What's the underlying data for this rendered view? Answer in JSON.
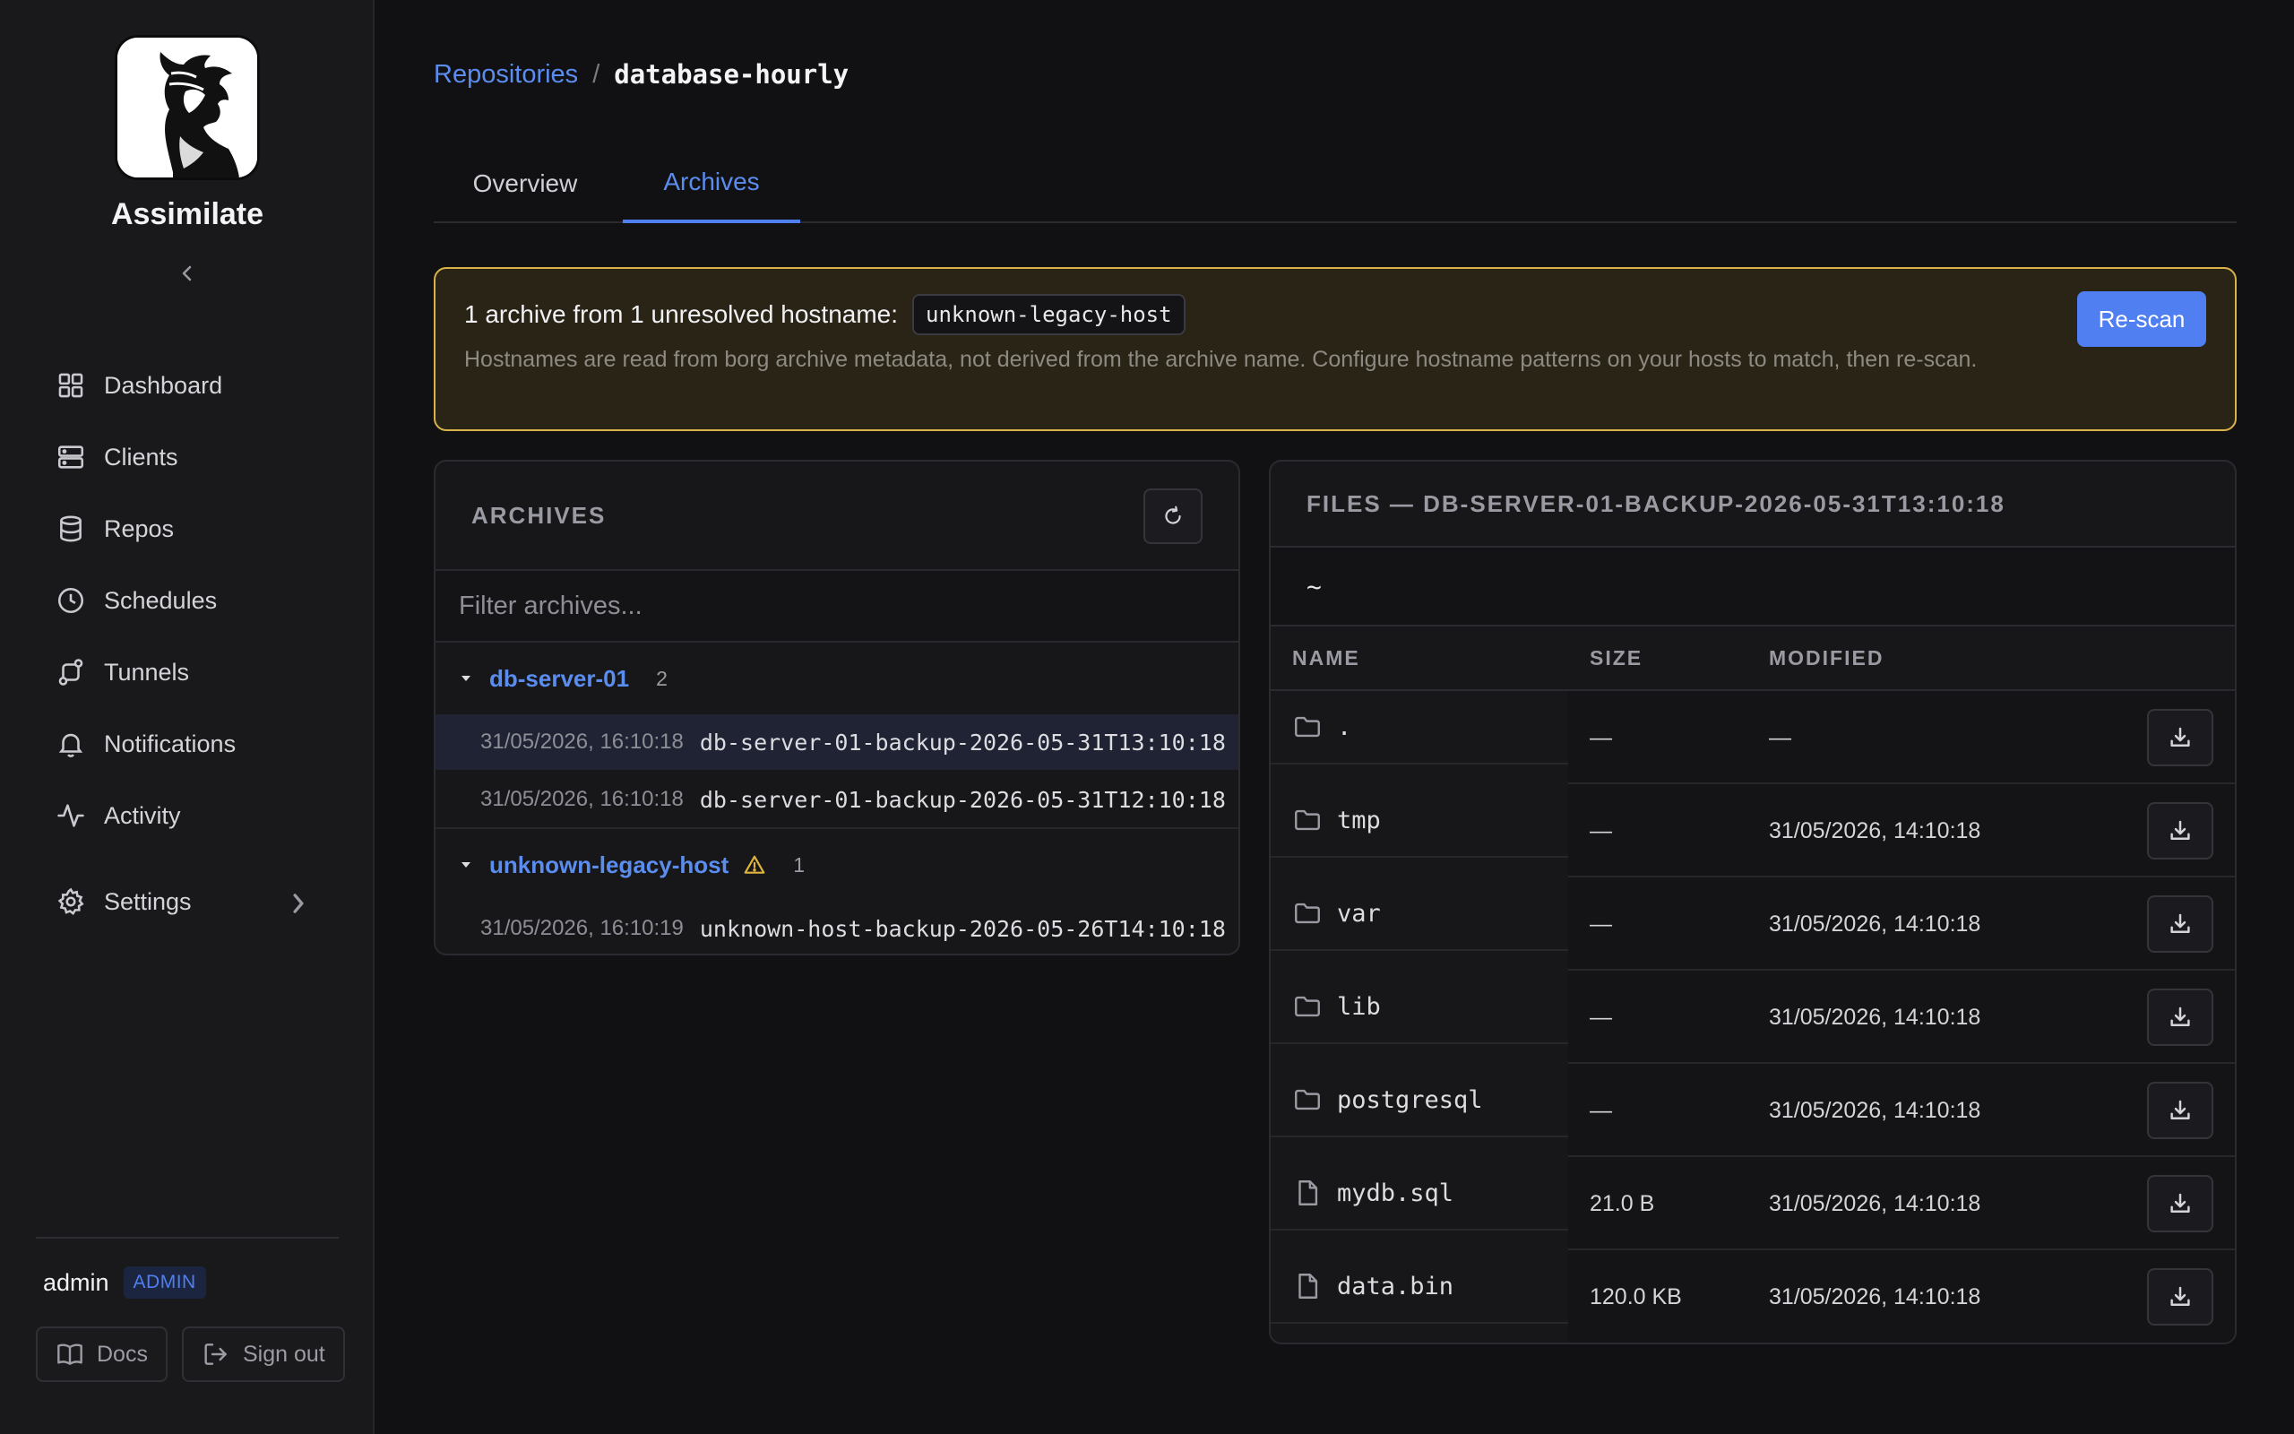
{
  "sidebar": {
    "brand": "Assimilate",
    "nav": [
      {
        "label": "Dashboard",
        "icon": "grid-icon"
      },
      {
        "label": "Clients",
        "icon": "server-icon"
      },
      {
        "label": "Repos",
        "icon": "database-icon"
      },
      {
        "label": "Schedules",
        "icon": "clock-icon"
      },
      {
        "label": "Tunnels",
        "icon": "route-icon"
      },
      {
        "label": "Notifications",
        "icon": "bell-icon"
      },
      {
        "label": "Activity",
        "icon": "activity-icon"
      }
    ],
    "settings_label": "Settings",
    "user": {
      "name": "admin",
      "role": "ADMIN"
    },
    "docs_label": "Docs",
    "signout_label": "Sign out"
  },
  "breadcrumb": {
    "parent": "Repositories",
    "separator": "/",
    "current": "database-hourly"
  },
  "tabs": [
    {
      "label": "Overview",
      "active": false
    },
    {
      "label": "Archives",
      "active": true
    }
  ],
  "banner": {
    "title": "1 archive from 1 unresolved hostname:",
    "hostname": "unknown-legacy-host",
    "description": "Hostnames are read from borg archive metadata, not derived from the archive name. Configure hostname patterns on your hosts to match, then re-scan.",
    "action": "Re-scan"
  },
  "archives": {
    "title": "ARCHIVES",
    "filter_placeholder": "Filter archives...",
    "groups": [
      {
        "host": "db-server-01",
        "count": "2",
        "warning": false,
        "items": [
          {
            "date": "31/05/2026, 16:10:18",
            "name": "db-server-01-backup-2026-05-31T13:10:18",
            "selected": true
          },
          {
            "date": "31/05/2026, 16:10:18",
            "name": "db-server-01-backup-2026-05-31T12:10:18",
            "selected": false
          }
        ]
      },
      {
        "host": "unknown-legacy-host",
        "count": "1",
        "warning": true,
        "items": [
          {
            "date": "31/05/2026, 16:10:19",
            "name": "unknown-host-backup-2026-05-26T14:10:18",
            "selected": false
          }
        ]
      }
    ]
  },
  "files": {
    "title": "FILES — DB-SERVER-01-BACKUP-2026-05-31T13:10:18",
    "path": "~",
    "columns": {
      "name": "NAME",
      "size": "SIZE",
      "modified": "MODIFIED"
    },
    "rows": [
      {
        "name": ".",
        "type": "folder",
        "size": "—",
        "modified": "—"
      },
      {
        "name": "tmp",
        "type": "folder",
        "size": "—",
        "modified": "31/05/2026, 14:10:18"
      },
      {
        "name": "var",
        "type": "folder",
        "size": "—",
        "modified": "31/05/2026, 14:10:18"
      },
      {
        "name": "lib",
        "type": "folder",
        "size": "—",
        "modified": "31/05/2026, 14:10:18"
      },
      {
        "name": "postgresql",
        "type": "folder",
        "size": "—",
        "modified": "31/05/2026, 14:10:18"
      },
      {
        "name": "mydb.sql",
        "type": "file",
        "size": "21.0 B",
        "modified": "31/05/2026, 14:10:18"
      },
      {
        "name": "data.bin",
        "type": "file",
        "size": "120.0 KB",
        "modified": "31/05/2026, 14:10:18"
      }
    ]
  },
  "colors": {
    "accent": "#4f7ff0",
    "link": "#5b8def",
    "warning": "#d9b24a",
    "background": "#111114"
  }
}
